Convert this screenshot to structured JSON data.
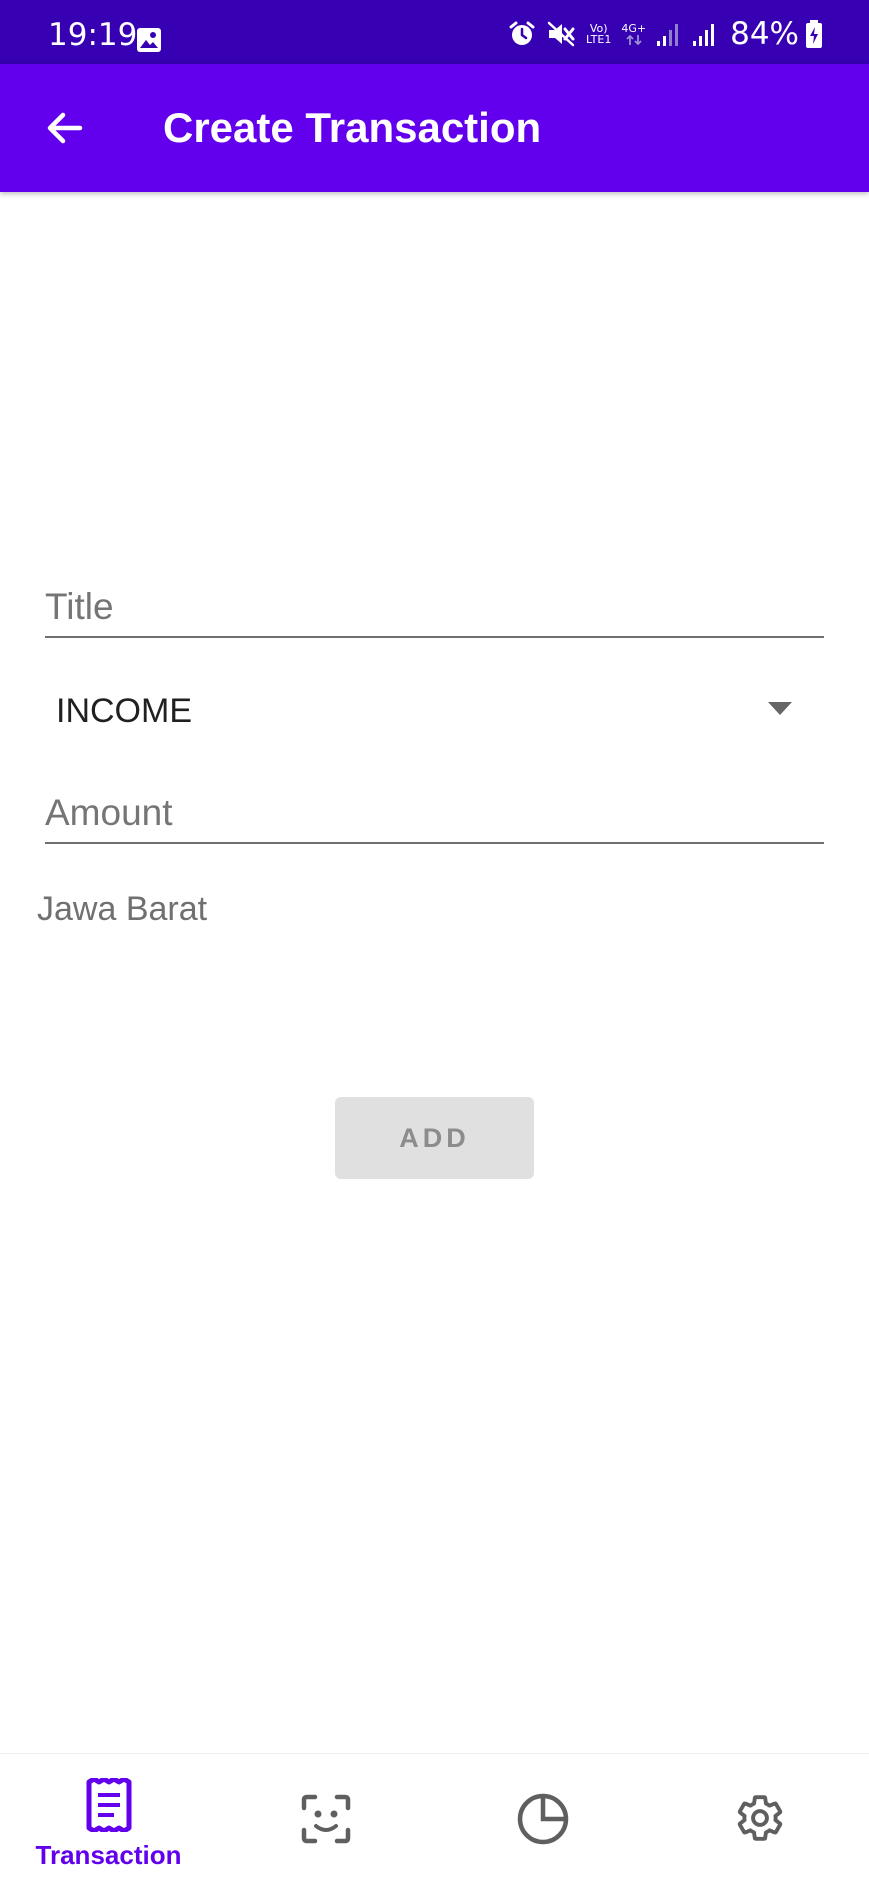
{
  "status_bar": {
    "time": "19:19",
    "network_top": "Vo)",
    "network_bottom": "LTE1",
    "data_type": "4G+",
    "battery": "84%"
  },
  "app_bar": {
    "title": "Create Transaction",
    "back_icon": "arrow-back-icon",
    "background_color": "#6200ee"
  },
  "form": {
    "title_placeholder": "Title",
    "title_value": "",
    "type_selected": "INCOME",
    "amount_placeholder": "Amount",
    "amount_value": "",
    "location": "Jawa Barat",
    "add_label": "ADD"
  },
  "bottom_nav": {
    "items": [
      {
        "label": "Transaction",
        "icon": "receipt-icon",
        "active": true
      },
      {
        "label": "",
        "icon": "face-scan-icon",
        "active": false
      },
      {
        "label": "",
        "icon": "pie-chart-icon",
        "active": false
      },
      {
        "label": "",
        "icon": "settings-icon",
        "active": false
      }
    ],
    "active_color": "#6200ee",
    "inactive_color": "#5f5f5f"
  }
}
